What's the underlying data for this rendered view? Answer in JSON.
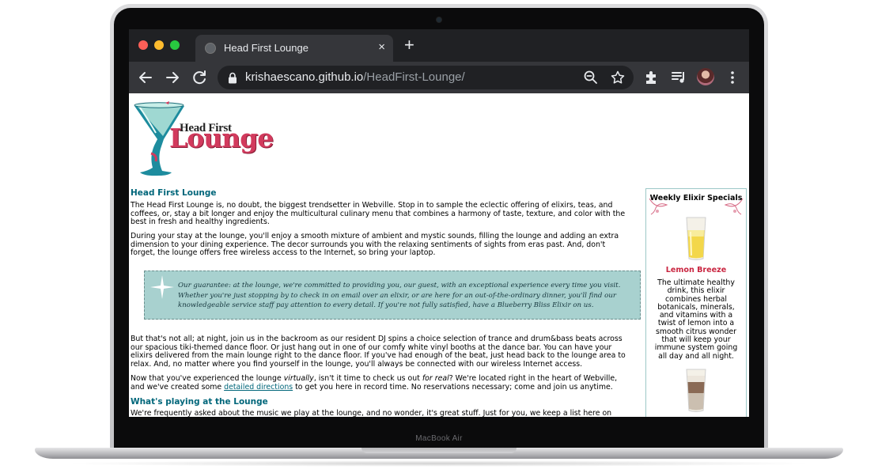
{
  "device": {
    "model_label": "MacBook Air"
  },
  "browser": {
    "tab_title": "Head First Lounge",
    "tab_close": "×",
    "new_tab": "+",
    "url_domain": "krishaescano.github.io",
    "url_path": "/HeadFirst-Lounge/",
    "icons": [
      "back-arrow-icon",
      "forward-arrow-icon",
      "reload-icon",
      "lock-icon",
      "zoom-icon",
      "star-icon",
      "extensions-icon",
      "media-icon",
      "avatar",
      "menu-icon"
    ],
    "window_dot_colors": [
      "#ff5f57",
      "#febc2e",
      "#28c840"
    ]
  },
  "page": {
    "logo": {
      "line1": "Head First",
      "line2": "Lounge"
    },
    "title": "Head First Lounge",
    "intro": "The Head First Lounge is, no doubt, the biggest trendsetter in Webville. Stop in to sample the eclectic offering of elixirs, teas, and coffees, or, stay a bit longer and enjoy the multicultural culinary menu that combines a harmony of taste, texture, and color with the best in fresh and healthy ingredients.",
    "stay": "During your stay at the lounge, you'll enjoy a smooth mixture of ambient and mystic sounds, filling the lounge and adding an extra dimension to your dining experience. The decor surrounds you with the relaxing sentiments of sights from eras past. And, don't forget, the lounge offers free wireless access to the Internet, so bring your laptop.",
    "guarantee": "Our guarantee: at the lounge, we're committed to providing you, our guest, with an exceptional experience every time you visit. Whether you're just stopping by to check in on email over an elixir, or are here for an out-of-the-ordinary dinner, you'll find our knowledgeable service staff pay attention to every detail. If you're not fully satisfied, have a Blueberry Bliss Elixir on us.",
    "night": "But that's not all; at night, join us in the backroom as our resident DJ spins a choice selection of trance and drum&bass beats across our spacious tiki-themed dance floor. Or just hang out in one of our comfy white vinyl booths at the dance bar. You can have your elixirs delivered from the main lounge right to the dance floor. If you've had enough of the beat, just head back to the lounge area to relax. And, no matter where you find yourself in the lounge, you'll always be connected with our wireless Internet access.",
    "visit_a": "Now that you've experienced the lounge ",
    "visit_virtually": "virtually",
    "visit_b": ", isn't it time to check us out ",
    "visit_forreal": "for real",
    "visit_c": "? We're located right in the heart of Webville, and we've created some ",
    "visit_link": "detailed directions",
    "visit_d": " to get you here in record time. No reservations necessary; come and join us anytime.",
    "music_heading": "What's playing at the Lounge",
    "music_text": "We're frequently asked about the music we play at the lounge, and no wonder, it's great stuff. Just for you, we keep a list here on"
  },
  "sidebar": {
    "title": "Weekly Elixir Specials",
    "drink_name": "Lemon Breeze",
    "drink_desc": "The ultimate healthy drink, this elixir combines herbal botanicals, minerals, and vitamins with a twist of lemon into a smooth citrus wonder that will keep your immune system going all day and all night."
  },
  "colors": {
    "heading": "#00667a",
    "lounge_red": "#d23a5d",
    "guarantee_bg": "#a8d1cf",
    "drink_name": "#c9243f"
  }
}
